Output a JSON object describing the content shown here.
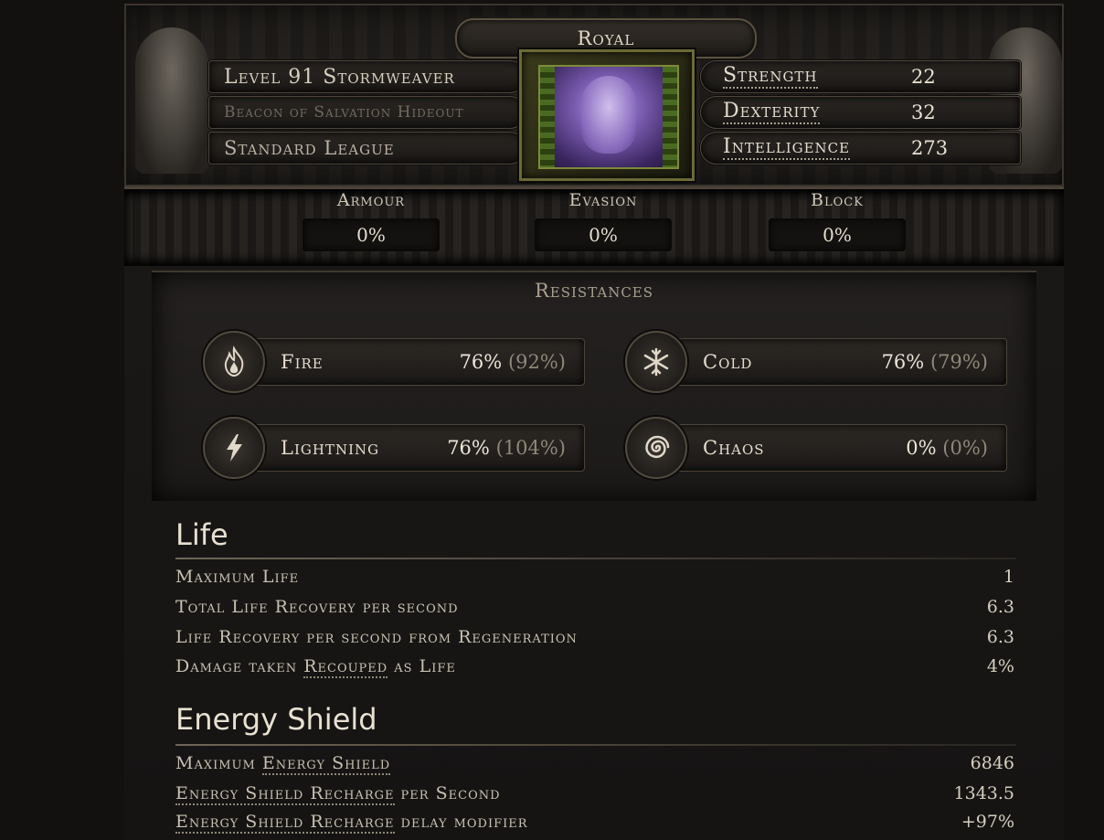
{
  "header": {
    "title": "Royal",
    "char_line": "Level 91 Stormweaver",
    "location": "Beacon of Salvation Hideout",
    "league": "Standard League"
  },
  "attributes": [
    {
      "name": "Strength",
      "value": "22"
    },
    {
      "name": "Dexterity",
      "value": "32"
    },
    {
      "name": "Intelligence",
      "value": "273"
    }
  ],
  "defences": [
    {
      "label": "Armour",
      "value": "0%"
    },
    {
      "label": "Evasion",
      "value": "0%"
    },
    {
      "label": "Block",
      "value": "0%"
    }
  ],
  "resistances": {
    "title": "Resistances",
    "items": [
      {
        "name": "Fire",
        "value": "76%",
        "max": "(92%)",
        "icon": "fire-icon"
      },
      {
        "name": "Cold",
        "value": "76%",
        "max": "(79%)",
        "icon": "snowflake-icon"
      },
      {
        "name": "Lightning",
        "value": "76%",
        "max": "(104%)",
        "icon": "lightning-icon"
      },
      {
        "name": "Chaos",
        "value": "0%",
        "max": "(0%)",
        "icon": "spiral-icon"
      }
    ]
  },
  "life": {
    "title": "Life",
    "rows": [
      {
        "pre": "Maximum Life",
        "und": "",
        "post": "",
        "value": "1"
      },
      {
        "pre": "Total Life Recovery per second",
        "und": "",
        "post": "",
        "value": "6.3"
      },
      {
        "pre": "Life Recovery per second from Regeneration",
        "und": "",
        "post": "",
        "value": "6.3"
      },
      {
        "pre": "Damage taken ",
        "und": "Recouped",
        "post": " as Life",
        "value": "4%"
      }
    ]
  },
  "energy_shield": {
    "title": "Energy Shield",
    "rows": [
      {
        "pre": "Maximum ",
        "und": "Energy Shield",
        "post": "",
        "value": "6846"
      },
      {
        "pre": "",
        "und": "Energy Shield Recharge",
        "post": " per Second",
        "value": "1343.5"
      },
      {
        "pre": "",
        "und": "Energy Shield Recharge",
        "post": " delay modifier",
        "value": "+97%"
      }
    ]
  }
}
